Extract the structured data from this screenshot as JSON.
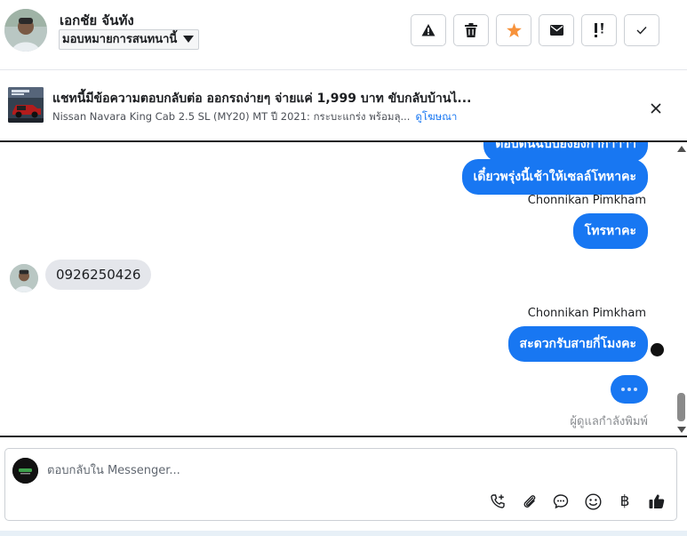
{
  "header": {
    "contact_name": "เอกชัย จันทัง",
    "assign_label": "มอบหมายการสนทนานี้",
    "actions": [
      {
        "name": "report-spam",
        "icon": "warning-icon"
      },
      {
        "name": "delete",
        "icon": "trash-icon"
      },
      {
        "name": "star",
        "icon": "star-icon",
        "color": "#f7923b"
      },
      {
        "name": "mark-unread",
        "icon": "envelope-icon"
      },
      {
        "name": "follow-up",
        "icon": "exclamation-icon"
      },
      {
        "name": "mark-done",
        "icon": "check-icon"
      }
    ]
  },
  "ad": {
    "title": "แชทนี้มีข้อความตอบกลับต่อ ออกรถง่ายๆ จ่ายแค่ 1,999 บาท ขับกลับบ้านไ...",
    "subtitle": "Nissan Navara King Cab 2.5 SL (MY20) MT ปี 2021: กระบะแกร่ง พร้อมลุ...",
    "link_label": "ดูโฆษณา"
  },
  "messages": {
    "partial_top": "ตอบต้นฉบับยังยังกากาาาา",
    "out1": "เดี๋ยวพรุ่งนี้เช้าให้เซลล์โทหาคะ",
    "sender1": "Chonnikan Pimkham",
    "out2": "โทรหาคะ",
    "in1": "0926250426",
    "sender2": "Chonnikan Pimkham",
    "out3": "สะดวกรับสายกี่โมงคะ",
    "typing_label": "ผู้ดูแลกำลังพิมพ์"
  },
  "composer": {
    "placeholder": "ตอบกลับใน Messenger...",
    "tools": [
      "phone-plus-icon",
      "paperclip-icon",
      "chat-bubble-icon",
      "smiley-icon",
      "baht-icon",
      "thumbs-up-icon"
    ],
    "baht_symbol": "฿"
  },
  "colors": {
    "accent": "#1877f2",
    "star": "#f7923b"
  }
}
